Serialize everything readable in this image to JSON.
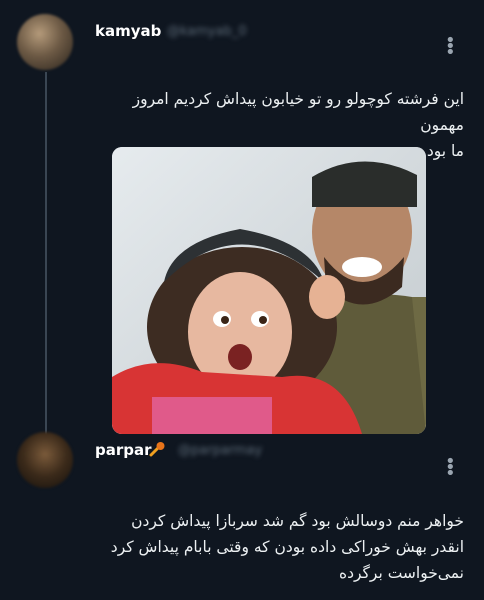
{
  "posts": [
    {
      "username": "kamyab",
      "handle": "@kamyab_0",
      "text": "این فرشته کوچولو رو تو خیابون پیداش کردیم امروز مهمون\nما بود"
    },
    {
      "username": "parpar",
      "handle": "@parparmay",
      "text": "خواهر منم دوسالش بود گم شد سربازا پیداش کردن\nانقدر بهش خوراکی داده بودن که وقتی بابام پیداش کرد\nنمی‌خواست برگرده"
    }
  ],
  "icons": {
    "more": "more-vertical-icon",
    "badge": "comet-icon"
  },
  "colors": {
    "background": "#0f1620",
    "thread_line": "#3a4653",
    "text": "#ecf0f2",
    "handle": "#5d6b78"
  }
}
